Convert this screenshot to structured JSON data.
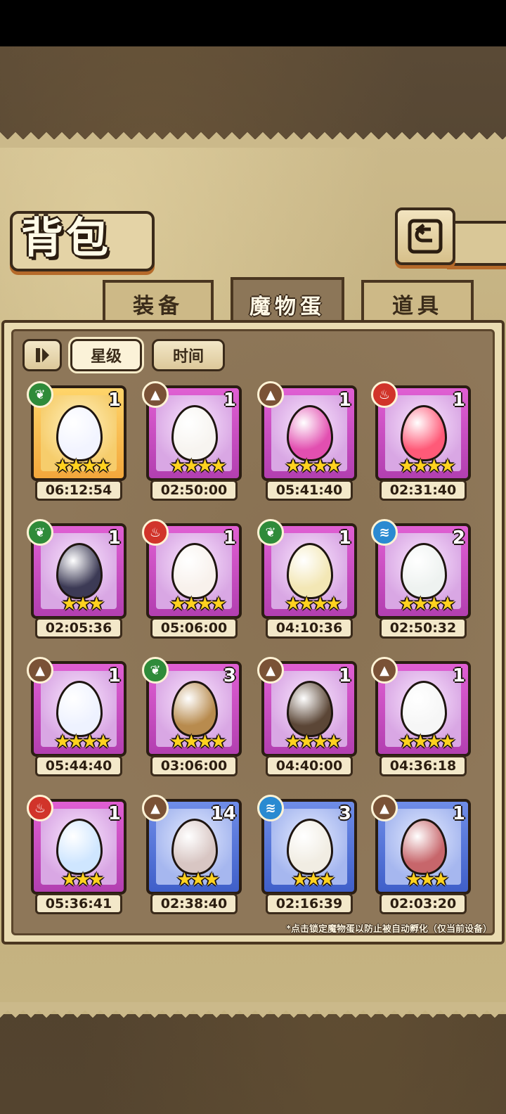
{
  "title": "背包",
  "tabs": [
    {
      "label": "装备",
      "active": false
    },
    {
      "label": "魔物蛋",
      "active": true
    },
    {
      "label": "道具",
      "active": false
    }
  ],
  "controls": {
    "sort_toggle_icon": "pause-toggle-icon",
    "sort_star": "星级",
    "sort_time": "时间",
    "selected": "星级"
  },
  "eggs": [
    {
      "element": "grass",
      "count": "1",
      "stars": 4,
      "frame": "gold",
      "timer": "06:12:54",
      "egg_color": "#f2f4ff"
    },
    {
      "element": "earth",
      "count": "1",
      "stars": 4,
      "frame": "purple",
      "timer": "02:50:00",
      "egg_color": "#f7f4f0"
    },
    {
      "element": "earth",
      "count": "1",
      "stars": 4,
      "frame": "purple",
      "timer": "05:41:40",
      "egg_color": "#e24fb0"
    },
    {
      "element": "fire",
      "count": "1",
      "stars": 4,
      "frame": "purple",
      "timer": "02:31:40",
      "egg_color": "#ff5a78"
    },
    {
      "element": "grass",
      "count": "1",
      "stars": 3,
      "frame": "purple",
      "timer": "02:05:36",
      "egg_color": "#3c3a55"
    },
    {
      "element": "fire",
      "count": "1",
      "stars": 4,
      "frame": "purple",
      "timer": "05:06:00",
      "egg_color": "#f8f1ec"
    },
    {
      "element": "grass",
      "count": "1",
      "stars": 4,
      "frame": "purple",
      "timer": "04:10:36",
      "egg_color": "#f3e7b5"
    },
    {
      "element": "water",
      "count": "2",
      "stars": 4,
      "frame": "purple",
      "timer": "02:50:32",
      "egg_color": "#eef2f0"
    },
    {
      "element": "earth",
      "count": "1",
      "stars": 4,
      "frame": "purple",
      "timer": "05:44:40",
      "egg_color": "#eef2ff"
    },
    {
      "element": "grass",
      "count": "3",
      "stars": 4,
      "frame": "purple",
      "timer": "03:06:00",
      "egg_color": "#b88b4e"
    },
    {
      "element": "earth",
      "count": "1",
      "stars": 4,
      "frame": "purple",
      "timer": "04:40:00",
      "egg_color": "#5b4636"
    },
    {
      "element": "earth",
      "count": "1",
      "stars": 4,
      "frame": "purple",
      "timer": "04:36:18",
      "egg_color": "#f6f6f6"
    },
    {
      "element": "fire",
      "count": "1",
      "stars": 3,
      "frame": "purple",
      "timer": "05:36:41",
      "egg_color": "#cfe6ff"
    },
    {
      "element": "earth",
      "count": "14",
      "stars": 3,
      "frame": "blue",
      "timer": "02:38:40",
      "egg_color": "#d8c6c3"
    },
    {
      "element": "water",
      "count": "3",
      "stars": 3,
      "frame": "blue",
      "timer": "02:16:39",
      "egg_color": "#f1ede3"
    },
    {
      "element": "earth",
      "count": "1",
      "stars": 3,
      "frame": "blue",
      "timer": "02:03:20",
      "egg_color": "#c7666b"
    }
  ],
  "hint": "*点击锁定魔物蛋以防止被自动孵化（仅当前设备）"
}
